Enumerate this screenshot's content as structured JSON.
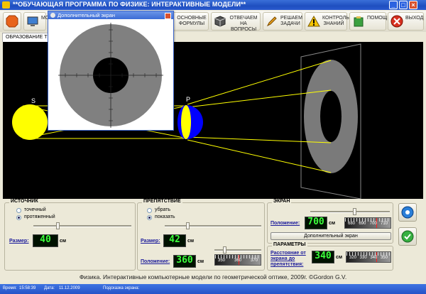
{
  "window": {
    "title": "**ОБУЧАЮЩАЯ ПРОГРАММА ПО ФИЗИКЕ: ИНТЕРАКТИВНЫЕ МОДЕЛИ**"
  },
  "toolbar": {
    "items": [
      {
        "label": "МО",
        "icon": "monitor-icon"
      },
      {
        "label": "ОСНОВНЫЕ ФОРМУЛЫ",
        "icon": "book-icon"
      },
      {
        "label": "ОТВЕЧАЕМ НА ВОПРОСЫ",
        "icon": "cube-icon"
      },
      {
        "label": "РЕШАЕМ ЗАДАЧИ",
        "icon": "pencil-icon"
      },
      {
        "label": "КОНТРОЛЬ ЗНАНИЙ",
        "icon": "warning-icon"
      },
      {
        "label": "ПОМОЩЬ",
        "icon": "help-icon"
      },
      {
        "label": "ВЫХОД",
        "icon": "exit-icon"
      }
    ]
  },
  "tab": {
    "label": "ОБРАЗОВАНИЕ ТЕ"
  },
  "scene": {
    "source_label": "S",
    "obstacle_label": "P",
    "colors": {
      "source": "#ffff00",
      "obstacle_lit": "#ffff00",
      "obstacle_dark": "#0000ff",
      "ray": "#ffff00",
      "screen_ring": "#808080"
    }
  },
  "popup": {
    "title": "Дополнительный экран"
  },
  "source_panel": {
    "title": "ИСТОЧНИК",
    "option_point": "точечный",
    "option_extended": "протяженный",
    "selected": "протяженный",
    "size_label": "Размер:",
    "size_value": "40",
    "unit": "см"
  },
  "obstacle_panel": {
    "title": "ПРЕПЯТСТВИЕ",
    "option_remove": "убрать",
    "option_show": "показать",
    "selected": "показать",
    "size_label": "Размер:",
    "size_value": "42",
    "position_label": "Положение:",
    "position_value": "360",
    "unit": "см",
    "ruler": [
      "350",
      "360",
      "370"
    ]
  },
  "screen_panel": {
    "title": "ЭКРАН",
    "position_label": "Положение:",
    "position_value": "700",
    "unit": "см",
    "ruler": [
      "680",
      "690",
      "700",
      "710"
    ],
    "extra_screen_button": "Дополнительный экран"
  },
  "params_panel": {
    "title": "ПАРАМЕТРЫ",
    "distance_label": "Расстояние от экрана до препятствия:",
    "distance_value": "340",
    "unit": "см",
    "ruler": [
      "320",
      "330",
      "340",
      "350"
    ]
  },
  "caption": "Физика. Интерактивные компьютерные модели по геометрической оптике, 2009г. ©Gordon G.V.",
  "status": {
    "time_label": "Время:",
    "time": "15:58:39",
    "date_label": "Дата:",
    "date": "11.12.2009",
    "hint_label": "Подсказка экрана:"
  }
}
